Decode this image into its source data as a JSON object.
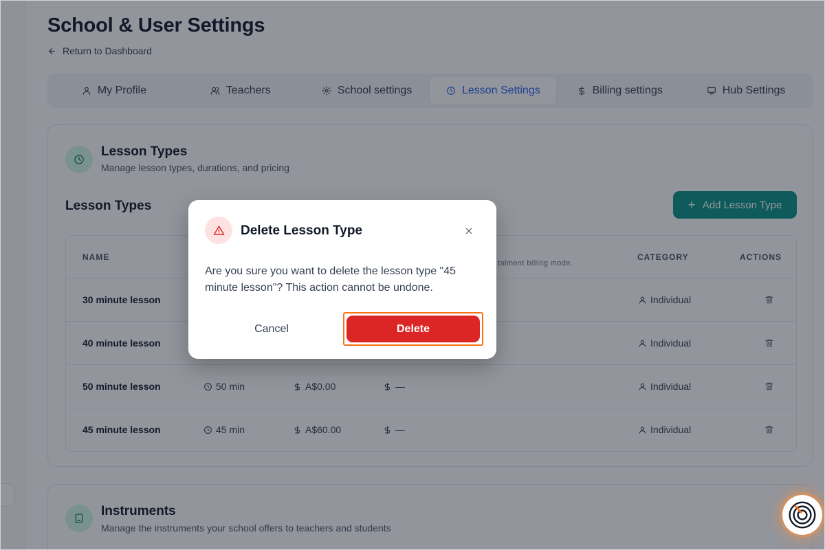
{
  "page": {
    "title": "School & User Settings",
    "back_link": "Return to Dashboard"
  },
  "tabs": [
    {
      "label": "My Profile",
      "icon": "user-icon",
      "active": false
    },
    {
      "label": "Teachers",
      "icon": "users-icon",
      "active": false
    },
    {
      "label": "School settings",
      "icon": "gear-icon",
      "active": false
    },
    {
      "label": "Lesson Settings",
      "icon": "clock-icon",
      "active": true
    },
    {
      "label": "Billing settings",
      "icon": "dollar-icon",
      "active": false
    },
    {
      "label": "Hub Settings",
      "icon": "monitor-icon",
      "active": false
    }
  ],
  "lesson_types_card": {
    "title": "Lesson Types",
    "subtitle": "Manage lesson types, durations, and pricing",
    "section_heading": "Lesson Types",
    "add_button": "Add Lesson Type",
    "columns": {
      "name": "NAME",
      "billing_note": "talment billing mode.",
      "category": "CATEGORY",
      "actions": "ACTIONS"
    },
    "rows": [
      {
        "name": "30 minute lesson",
        "duration": "",
        "price": "",
        "instalment": "",
        "category": "Individual"
      },
      {
        "name": "40 minute lesson",
        "duration": "",
        "price": "",
        "instalment": "",
        "category": "Individual"
      },
      {
        "name": "50 minute lesson",
        "duration": "50 min",
        "price": "A$0.00",
        "instalment": "—",
        "category": "Individual"
      },
      {
        "name": "45 minute lesson",
        "duration": "45 min",
        "price": "A$60.00",
        "instalment": "—",
        "category": "Individual"
      }
    ]
  },
  "instruments_card": {
    "title": "Instruments",
    "subtitle": "Manage the instruments your school offers to teachers and students"
  },
  "modal": {
    "title": "Delete Lesson Type",
    "body": "Are you sure you want to delete the lesson type \"45 minute lesson\"? This action cannot be undone.",
    "cancel": "Cancel",
    "delete": "Delete"
  },
  "colors": {
    "accent": "#0d9488",
    "active_tab": "#2563eb",
    "danger": "#dc2626",
    "focus_ring": "#f97316"
  }
}
